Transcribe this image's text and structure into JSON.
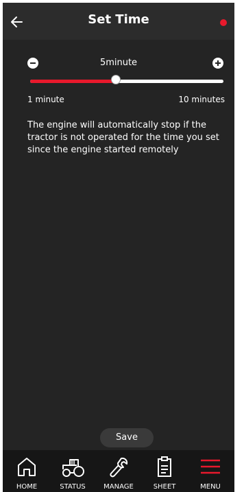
{
  "header": {
    "title": "Set Time",
    "back_icon": "arrow-left-icon",
    "status_dot_color": "#e8192c"
  },
  "slider": {
    "value_label": "5minute",
    "min_label": "1 minute",
    "max_label": "10 minutes",
    "min": 1,
    "max": 10,
    "value": 5,
    "accent_color": "#e8192c"
  },
  "description": "The engine will automatically stop if the tractor is not operated for the time you set since the engine started remotely",
  "save_label": "Save",
  "nav": [
    {
      "label": "HOME",
      "icon": "home-icon"
    },
    {
      "label": "STATUS",
      "icon": "tractor-icon"
    },
    {
      "label": "MANAGE",
      "icon": "wrench-icon"
    },
    {
      "label": "SHEET",
      "icon": "clipboard-icon"
    },
    {
      "label": "MENU",
      "icon": "hamburger-menu-icon",
      "active": true
    }
  ]
}
